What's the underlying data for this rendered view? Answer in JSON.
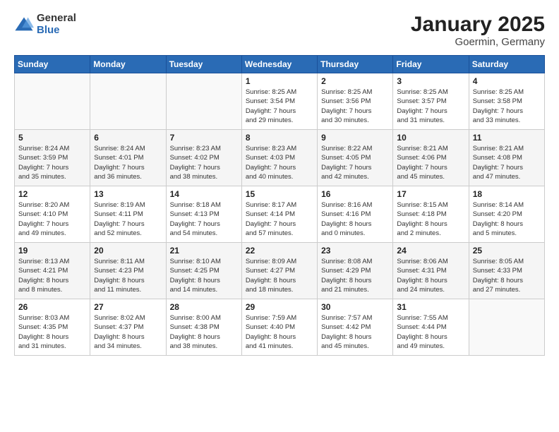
{
  "logo": {
    "general": "General",
    "blue": "Blue"
  },
  "title": "January 2025",
  "subtitle": "Goermin, Germany",
  "days_of_week": [
    "Sunday",
    "Monday",
    "Tuesday",
    "Wednesday",
    "Thursday",
    "Friday",
    "Saturday"
  ],
  "weeks": [
    [
      {
        "day": "",
        "info": ""
      },
      {
        "day": "",
        "info": ""
      },
      {
        "day": "",
        "info": ""
      },
      {
        "day": "1",
        "info": "Sunrise: 8:25 AM\nSunset: 3:54 PM\nDaylight: 7 hours\nand 29 minutes."
      },
      {
        "day": "2",
        "info": "Sunrise: 8:25 AM\nSunset: 3:56 PM\nDaylight: 7 hours\nand 30 minutes."
      },
      {
        "day": "3",
        "info": "Sunrise: 8:25 AM\nSunset: 3:57 PM\nDaylight: 7 hours\nand 31 minutes."
      },
      {
        "day": "4",
        "info": "Sunrise: 8:25 AM\nSunset: 3:58 PM\nDaylight: 7 hours\nand 33 minutes."
      }
    ],
    [
      {
        "day": "5",
        "info": "Sunrise: 8:24 AM\nSunset: 3:59 PM\nDaylight: 7 hours\nand 35 minutes."
      },
      {
        "day": "6",
        "info": "Sunrise: 8:24 AM\nSunset: 4:01 PM\nDaylight: 7 hours\nand 36 minutes."
      },
      {
        "day": "7",
        "info": "Sunrise: 8:23 AM\nSunset: 4:02 PM\nDaylight: 7 hours\nand 38 minutes."
      },
      {
        "day": "8",
        "info": "Sunrise: 8:23 AM\nSunset: 4:03 PM\nDaylight: 7 hours\nand 40 minutes."
      },
      {
        "day": "9",
        "info": "Sunrise: 8:22 AM\nSunset: 4:05 PM\nDaylight: 7 hours\nand 42 minutes."
      },
      {
        "day": "10",
        "info": "Sunrise: 8:21 AM\nSunset: 4:06 PM\nDaylight: 7 hours\nand 45 minutes."
      },
      {
        "day": "11",
        "info": "Sunrise: 8:21 AM\nSunset: 4:08 PM\nDaylight: 7 hours\nand 47 minutes."
      }
    ],
    [
      {
        "day": "12",
        "info": "Sunrise: 8:20 AM\nSunset: 4:10 PM\nDaylight: 7 hours\nand 49 minutes."
      },
      {
        "day": "13",
        "info": "Sunrise: 8:19 AM\nSunset: 4:11 PM\nDaylight: 7 hours\nand 52 minutes."
      },
      {
        "day": "14",
        "info": "Sunrise: 8:18 AM\nSunset: 4:13 PM\nDaylight: 7 hours\nand 54 minutes."
      },
      {
        "day": "15",
        "info": "Sunrise: 8:17 AM\nSunset: 4:14 PM\nDaylight: 7 hours\nand 57 minutes."
      },
      {
        "day": "16",
        "info": "Sunrise: 8:16 AM\nSunset: 4:16 PM\nDaylight: 8 hours\nand 0 minutes."
      },
      {
        "day": "17",
        "info": "Sunrise: 8:15 AM\nSunset: 4:18 PM\nDaylight: 8 hours\nand 2 minutes."
      },
      {
        "day": "18",
        "info": "Sunrise: 8:14 AM\nSunset: 4:20 PM\nDaylight: 8 hours\nand 5 minutes."
      }
    ],
    [
      {
        "day": "19",
        "info": "Sunrise: 8:13 AM\nSunset: 4:21 PM\nDaylight: 8 hours\nand 8 minutes."
      },
      {
        "day": "20",
        "info": "Sunrise: 8:11 AM\nSunset: 4:23 PM\nDaylight: 8 hours\nand 11 minutes."
      },
      {
        "day": "21",
        "info": "Sunrise: 8:10 AM\nSunset: 4:25 PM\nDaylight: 8 hours\nand 14 minutes."
      },
      {
        "day": "22",
        "info": "Sunrise: 8:09 AM\nSunset: 4:27 PM\nDaylight: 8 hours\nand 18 minutes."
      },
      {
        "day": "23",
        "info": "Sunrise: 8:08 AM\nSunset: 4:29 PM\nDaylight: 8 hours\nand 21 minutes."
      },
      {
        "day": "24",
        "info": "Sunrise: 8:06 AM\nSunset: 4:31 PM\nDaylight: 8 hours\nand 24 minutes."
      },
      {
        "day": "25",
        "info": "Sunrise: 8:05 AM\nSunset: 4:33 PM\nDaylight: 8 hours\nand 27 minutes."
      }
    ],
    [
      {
        "day": "26",
        "info": "Sunrise: 8:03 AM\nSunset: 4:35 PM\nDaylight: 8 hours\nand 31 minutes."
      },
      {
        "day": "27",
        "info": "Sunrise: 8:02 AM\nSunset: 4:37 PM\nDaylight: 8 hours\nand 34 minutes."
      },
      {
        "day": "28",
        "info": "Sunrise: 8:00 AM\nSunset: 4:38 PM\nDaylight: 8 hours\nand 38 minutes."
      },
      {
        "day": "29",
        "info": "Sunrise: 7:59 AM\nSunset: 4:40 PM\nDaylight: 8 hours\nand 41 minutes."
      },
      {
        "day": "30",
        "info": "Sunrise: 7:57 AM\nSunset: 4:42 PM\nDaylight: 8 hours\nand 45 minutes."
      },
      {
        "day": "31",
        "info": "Sunrise: 7:55 AM\nSunset: 4:44 PM\nDaylight: 8 hours\nand 49 minutes."
      },
      {
        "day": "",
        "info": ""
      }
    ]
  ]
}
